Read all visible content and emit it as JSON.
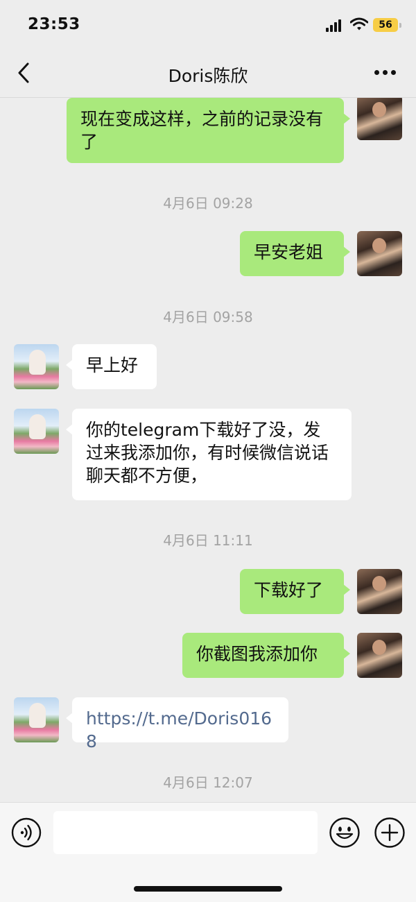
{
  "status_bar": {
    "time": "23:53",
    "battery": "56"
  },
  "nav": {
    "title": "Doris陈欣"
  },
  "messages": [
    {
      "text": "现在变成这样，之前的记录没有了"
    },
    {
      "text": "早安老姐"
    },
    {
      "text": "早上好"
    },
    {
      "text": "你的telegram下载好了没，发过来我添加你，有时候微信说话聊天都不方便，"
    },
    {
      "text": "下载好了"
    },
    {
      "text": "你截图我添加你"
    },
    {
      "text": "https://t.me/Doris0168"
    }
  ],
  "timestamps": [
    "4月6日 09:28",
    "4月6日 09:58",
    "4月6日 11:11",
    "4月6日 12:07"
  ],
  "input": {
    "placeholder": ""
  },
  "colors": {
    "outgoing_bubble": "#a9e97c",
    "incoming_bubble": "#ffffff",
    "background": "#ededed",
    "link": "#536a8e"
  },
  "icons": [
    "back-icon",
    "more-icon",
    "voice-icon",
    "emoji-icon",
    "plus-icon"
  ]
}
